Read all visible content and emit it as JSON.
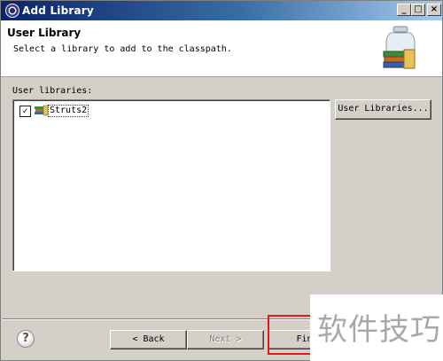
{
  "window": {
    "title": "Add Library",
    "controls": {
      "minimize": "_",
      "maximize": "□",
      "close": "×"
    }
  },
  "banner": {
    "title": "User Library",
    "description": "Select a library to add to the classpath.",
    "icon": "library-jar-icon"
  },
  "libraries": {
    "label": "User libraries:",
    "items": [
      {
        "label": "Struts2",
        "checked": true,
        "check_glyph": "✓"
      }
    ]
  },
  "buttons": {
    "user_libraries": "User Libraries...",
    "back": "< Back",
    "next": "Next >",
    "finish": "Fini"
  },
  "help_glyph": "?",
  "watermark": "软件技巧",
  "colors": {
    "highlight": "#e3181f",
    "titlebar": "#0a246a"
  }
}
